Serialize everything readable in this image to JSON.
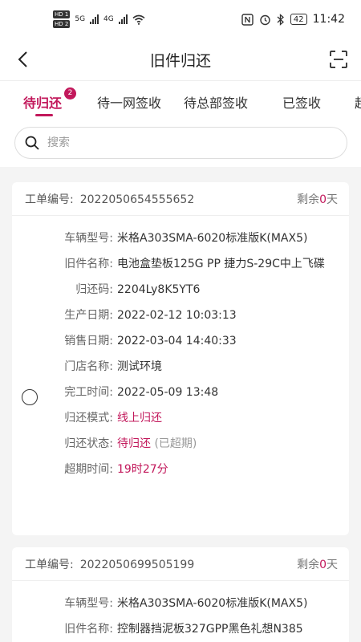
{
  "status_bar": {
    "sim1": "HD 1",
    "sim2": "HD 2",
    "net1": "5G",
    "net2": "4G",
    "battery": "42",
    "time": "11:42"
  },
  "header": {
    "title": "旧件归还"
  },
  "tabs": [
    {
      "label": "待归还",
      "badge": "2",
      "active": true
    },
    {
      "label": "待一网签收"
    },
    {
      "label": "待总部签收"
    },
    {
      "label": "已签收"
    },
    {
      "label": "超"
    }
  ],
  "search": {
    "placeholder": "搜索"
  },
  "orders": [
    {
      "order_label": "工单编号:",
      "order_no": "2022050654555652",
      "remain_prefix": "剩余",
      "remain_days": "0",
      "remain_suffix": "天",
      "fields": {
        "vehicle_model_label": "车辆型号:",
        "vehicle_model": "米格A303SMA-6020标准版K(MAX5)",
        "part_name_label": "旧件名称:",
        "part_name": "电池盒垫板125G PP 捷力S-29C中上飞碟",
        "return_code_label": "归还码:",
        "return_code": "2204Ly8K5YT6",
        "production_date_label": "生产日期:",
        "production_date": "2022-02-12 10:03:13",
        "sale_date_label": "销售日期:",
        "sale_date": "2022-03-04 14:40:33",
        "store_label": "门店名称:",
        "store": "测试环境",
        "finish_time_label": "完工时间:",
        "finish_time": "2022-05-09 13:48",
        "return_mode_label": "归还模式:",
        "return_mode": "线上归还",
        "return_status_label": "归还状态:",
        "return_status": "待归还",
        "return_status_note": "(已超期)",
        "overdue_label": "超期时间:",
        "overdue_time": "19时27分"
      }
    },
    {
      "order_label": "工单编号:",
      "order_no": "2022050699505199",
      "remain_prefix": "剩余",
      "remain_days": "0",
      "remain_suffix": "天",
      "fields": {
        "vehicle_model_label": "车辆型号:",
        "vehicle_model": "米格A303SMA-6020标准版K(MAX5)",
        "part_name_label": "旧件名称:",
        "part_name": "控制器挡泥板327GPP黑色礼想N385"
      }
    }
  ],
  "colors": {
    "accent": "#c2185b"
  }
}
